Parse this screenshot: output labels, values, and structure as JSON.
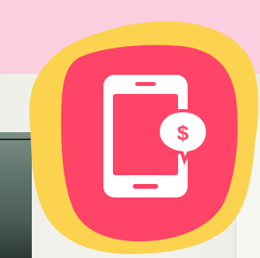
{
  "icon": {
    "semantic": "mobile-payment-icon",
    "currency_symbol": "$"
  },
  "colors": {
    "background_pink": "#fbcfe0",
    "outer_blob_yellow": "#fbd34f",
    "inner_blob_red": "#ff4467",
    "icon_white": "#ffffff"
  }
}
